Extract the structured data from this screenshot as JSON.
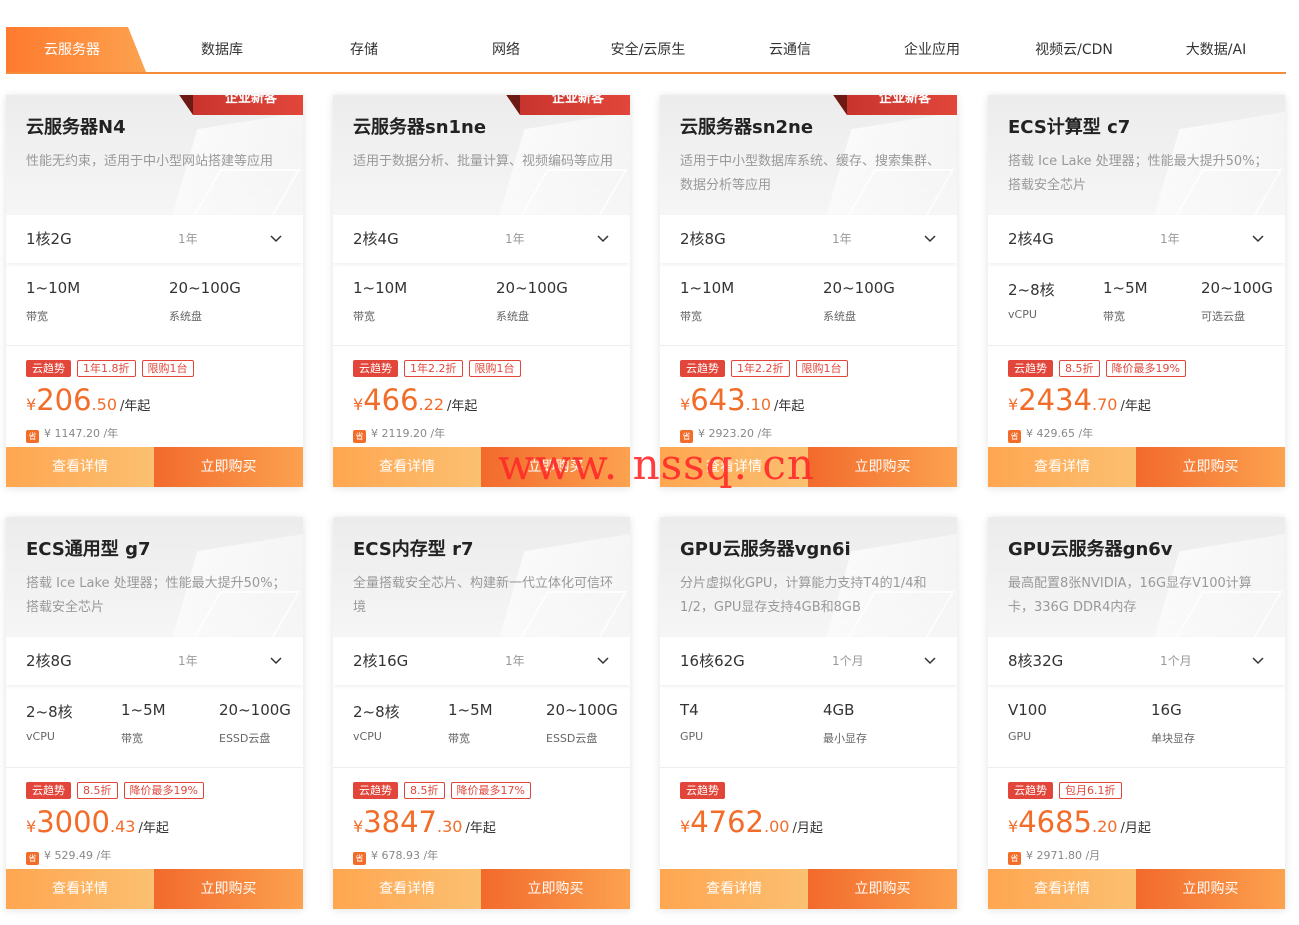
{
  "tabs": [
    {
      "label": "云服务器",
      "active": true
    },
    {
      "label": "数据库"
    },
    {
      "label": "存储"
    },
    {
      "label": "网络"
    },
    {
      "label": "安全/云原生"
    },
    {
      "label": "云通信"
    },
    {
      "label": "企业应用"
    },
    {
      "label": "视频云/CDN"
    },
    {
      "label": "大数据/AI"
    }
  ],
  "colors": {
    "accent": "#f26d2a",
    "ribbon": "#e2463a",
    "tag": "#e2463a"
  },
  "icons": {
    "dropdown": "chevron-down-icon",
    "save": "save-badge-icon"
  },
  "buttons": {
    "detail": "查看详情",
    "buy": "立即购买"
  },
  "watermark": "www. nssq. cn",
  "cards": [
    {
      "badge": "企业新客",
      "title": "云服务器N4",
      "desc": "性能无约束，适用于中小型网站搭建等应用",
      "spec": "1核2G",
      "duration": "1年",
      "params": [
        {
          "value": "1~10M",
          "label": "带宽"
        },
        {
          "value": "20~100G",
          "label": "系统盘"
        }
      ],
      "tags": [
        "云趋势",
        "1年1.8折",
        "限购1台"
      ],
      "price_int": "206",
      "price_dec": ".50",
      "price_unit": "/年起",
      "save_icon": "省",
      "orig_price": "¥ 1147.20 /年"
    },
    {
      "badge": "企业新客",
      "title": "云服务器sn1ne",
      "desc": "适用于数据分析、批量计算、视频编码等应用",
      "spec": "2核4G",
      "duration": "1年",
      "params": [
        {
          "value": "1~10M",
          "label": "带宽"
        },
        {
          "value": "20~100G",
          "label": "系统盘"
        }
      ],
      "tags": [
        "云趋势",
        "1年2.2折",
        "限购1台"
      ],
      "price_int": "466",
      "price_dec": ".22",
      "price_unit": "/年起",
      "save_icon": "省",
      "orig_price": "¥ 2119.20 /年"
    },
    {
      "badge": "企业新客",
      "title": "云服务器sn2ne",
      "desc": "适用于中小型数据库系统、缓存、搜索集群、数据分析等应用",
      "spec": "2核8G",
      "duration": "1年",
      "params": [
        {
          "value": "1~10M",
          "label": "带宽"
        },
        {
          "value": "20~100G",
          "label": "系统盘"
        }
      ],
      "tags": [
        "云趋势",
        "1年2.2折",
        "限购1台"
      ],
      "price_int": "643",
      "price_dec": ".10",
      "price_unit": "/年起",
      "save_icon": "省",
      "orig_price": "¥ 2923.20 /年"
    },
    {
      "badge": "",
      "title": "ECS计算型 c7",
      "desc": "搭载 Ice Lake 处理器；性能最大提升50%；搭载安全芯片",
      "spec": "2核4G",
      "duration": "1年",
      "params": [
        {
          "value": "2~8核",
          "label": "vCPU"
        },
        {
          "value": "1~5M",
          "label": "带宽"
        },
        {
          "value": "20~100G",
          "label": "可选云盘"
        }
      ],
      "tags": [
        "云趋势",
        "8.5折",
        "降价最多19%"
      ],
      "price_int": "2434",
      "price_dec": ".70",
      "price_unit": "/年起",
      "save_icon": "省",
      "orig_price": "¥ 429.65 /年"
    },
    {
      "badge": "",
      "title": "ECS通用型 g7",
      "desc": "搭载 Ice Lake 处理器；性能最大提升50%；搭载安全芯片",
      "spec": "2核8G",
      "duration": "1年",
      "params": [
        {
          "value": "2~8核",
          "label": "vCPU"
        },
        {
          "value": "1~5M",
          "label": "带宽"
        },
        {
          "value": "20~100G",
          "label": "ESSD云盘"
        }
      ],
      "tags": [
        "云趋势",
        "8.5折",
        "降价最多19%"
      ],
      "price_int": "3000",
      "price_dec": ".43",
      "price_unit": "/年起",
      "save_icon": "省",
      "orig_price": "¥ 529.49 /年"
    },
    {
      "badge": "",
      "title": "ECS内存型 r7",
      "desc": "全量搭载安全芯片、构建新一代立体化可信环境",
      "spec": "2核16G",
      "duration": "1年",
      "params": [
        {
          "value": "2~8核",
          "label": "vCPU"
        },
        {
          "value": "1~5M",
          "label": "带宽"
        },
        {
          "value": "20~100G",
          "label": "ESSD云盘"
        }
      ],
      "tags": [
        "云趋势",
        "8.5折",
        "降价最多17%"
      ],
      "price_int": "3847",
      "price_dec": ".30",
      "price_unit": "/年起",
      "save_icon": "省",
      "orig_price": "¥ 678.93 /年"
    },
    {
      "badge": "",
      "title": "GPU云服务器vgn6i",
      "desc": "分片虚拟化GPU，计算能力支持T4的1/4和1/2，GPU显存支持4GB和8GB",
      "spec": "16核62G",
      "duration": "1个月",
      "params": [
        {
          "value": "T4",
          "label": "GPU"
        },
        {
          "value": "4GB",
          "label": "最小显存"
        }
      ],
      "tags": [
        "云趋势"
      ],
      "price_int": "4762",
      "price_dec": ".00",
      "price_unit": "/月起",
      "save_icon": "",
      "orig_price": ""
    },
    {
      "badge": "",
      "title": "GPU云服务器gn6v",
      "desc": "最高配置8张NVIDIA，16G显存V100计算卡，336G DDR4内存",
      "spec": "8核32G",
      "duration": "1个月",
      "params": [
        {
          "value": "V100",
          "label": "GPU"
        },
        {
          "value": "16G",
          "label": "单块显存"
        }
      ],
      "tags": [
        "云趋势",
        "包月6.1折"
      ],
      "price_int": "4685",
      "price_dec": ".20",
      "price_unit": "/月起",
      "save_icon": "省",
      "orig_price": "¥ 2971.80 /月"
    }
  ]
}
